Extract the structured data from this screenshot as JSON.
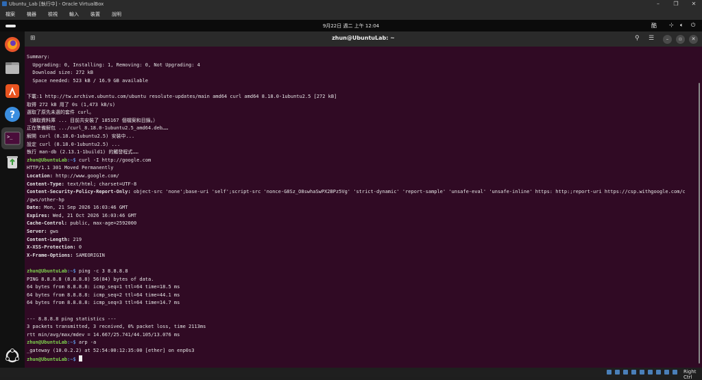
{
  "vbox": {
    "window_title": "Ubuntu_Lab [執行中] - Oracle VirtualBox",
    "menu": [
      "檔案",
      "機器",
      "檢視",
      "輸入",
      "裝置",
      "說明"
    ],
    "status_right": "Right Ctrl"
  },
  "topbar": {
    "clock": "9月22日 週二 上午 12:04",
    "input_method": "酷"
  },
  "terminal": {
    "title": "zhun@UbuntuLab: ~",
    "prompt_user": "zhun@UbuntuLab",
    "prompt_path": ":~$",
    "lines": [
      {
        "t": "Summary:"
      },
      {
        "t": "  Upgrading: 0, Installing: 1, Removing: 0, Not Upgrading: 4"
      },
      {
        "t": "  Download size: 272 kB"
      },
      {
        "t": "  Space needed: 523 kB / 16.9 GB available"
      },
      {
        "t": ""
      },
      {
        "t": "下載:1 http://tw.archive.ubuntu.com/ubuntu resolute-updates/main amd64 curl amd64 8.18.0-1ubuntu2.5 [272 kB]"
      },
      {
        "t": "取得 272 kB 用了 0s (1,473 kB/s)"
      },
      {
        "t": "選取了原先未選的套件 curl。"
      },
      {
        "t": "（讀取資料庫 ... 目前共安裝了 185167 個檔案和目錄。）"
      },
      {
        "t": "正在準備解包 .../curl_8.18.0-1ubuntu2.5_amd64.deb……"
      },
      {
        "t": "解開 curl (8.18.0-1ubuntu2.5) 安裝中..."
      },
      {
        "t": "設定 curl (8.18.0-1ubuntu2.5) ..."
      },
      {
        "t": "執行 man-db (2.13.1-1build1) 的觸發程式……"
      },
      {
        "type": "prompt",
        "cmd": " curl -I http://google.com"
      },
      {
        "t": "HTTP/1.1 301 Moved Permanently"
      },
      {
        "h": "Location:",
        "v": " http://www.google.com/"
      },
      {
        "h": "Content-Type:",
        "v": " text/html; charset=UTF-8"
      },
      {
        "h": "Content-Security-Policy-Report-Only:",
        "v": " object-src 'none';base-uri 'self';script-src 'nonce-G8Sz_O8swhaSwPX2BPz5Vg' 'strict-dynamic' 'report-sample' 'unsafe-eval' 'unsafe-inline' https: http:;report-uri https://csp.withgoogle.com/csp"
      },
      {
        "t": "/gws/other-hp"
      },
      {
        "h": "Date:",
        "v": " Mon, 21 Sep 2026 16:03:46 GMT"
      },
      {
        "h": "Expires:",
        "v": " Wed, 21 Oct 2026 16:03:46 GMT"
      },
      {
        "h": "Cache-Control:",
        "v": " public, max-age=2592000"
      },
      {
        "h": "Server:",
        "v": " gws"
      },
      {
        "h": "Content-Length:",
        "v": " 219"
      },
      {
        "h": "X-XSS-Protection:",
        "v": " 0"
      },
      {
        "h": "X-Frame-Options:",
        "v": " SAMEORIGIN"
      },
      {
        "t": ""
      },
      {
        "type": "prompt",
        "cmd": " ping -c 3 8.8.8.8"
      },
      {
        "t": "PING 8.8.8.8 (8.8.8.8) 56(84) bytes of data."
      },
      {
        "t": "64 bytes from 8.8.8.8: icmp_seq=1 ttl=64 time=18.5 ms"
      },
      {
        "t": "64 bytes from 8.8.8.8: icmp_seq=2 ttl=64 time=44.1 ms"
      },
      {
        "t": "64 bytes from 8.8.8.8: icmp_seq=3 ttl=64 time=14.7 ms"
      },
      {
        "t": ""
      },
      {
        "t": "--- 8.8.8.8 ping statistics ---"
      },
      {
        "t": "3 packets transmitted, 3 received, 0% packet loss, time 2113ms"
      },
      {
        "t": "rtt min/avg/max/mdev = 14.667/25.741/44.105/13.076 ms"
      },
      {
        "type": "prompt",
        "cmd": " arp -a"
      },
      {
        "t": "_gateway (10.0.2.2) at 52:54:00:12:35:00 [ether] on enp0s3"
      },
      {
        "type": "prompt",
        "cmd": " ",
        "cursor": true
      }
    ]
  },
  "colors": {
    "terminal_bg": "#300a24",
    "prompt_user": "#7fd34e",
    "prompt_path": "#5a8fd8"
  }
}
